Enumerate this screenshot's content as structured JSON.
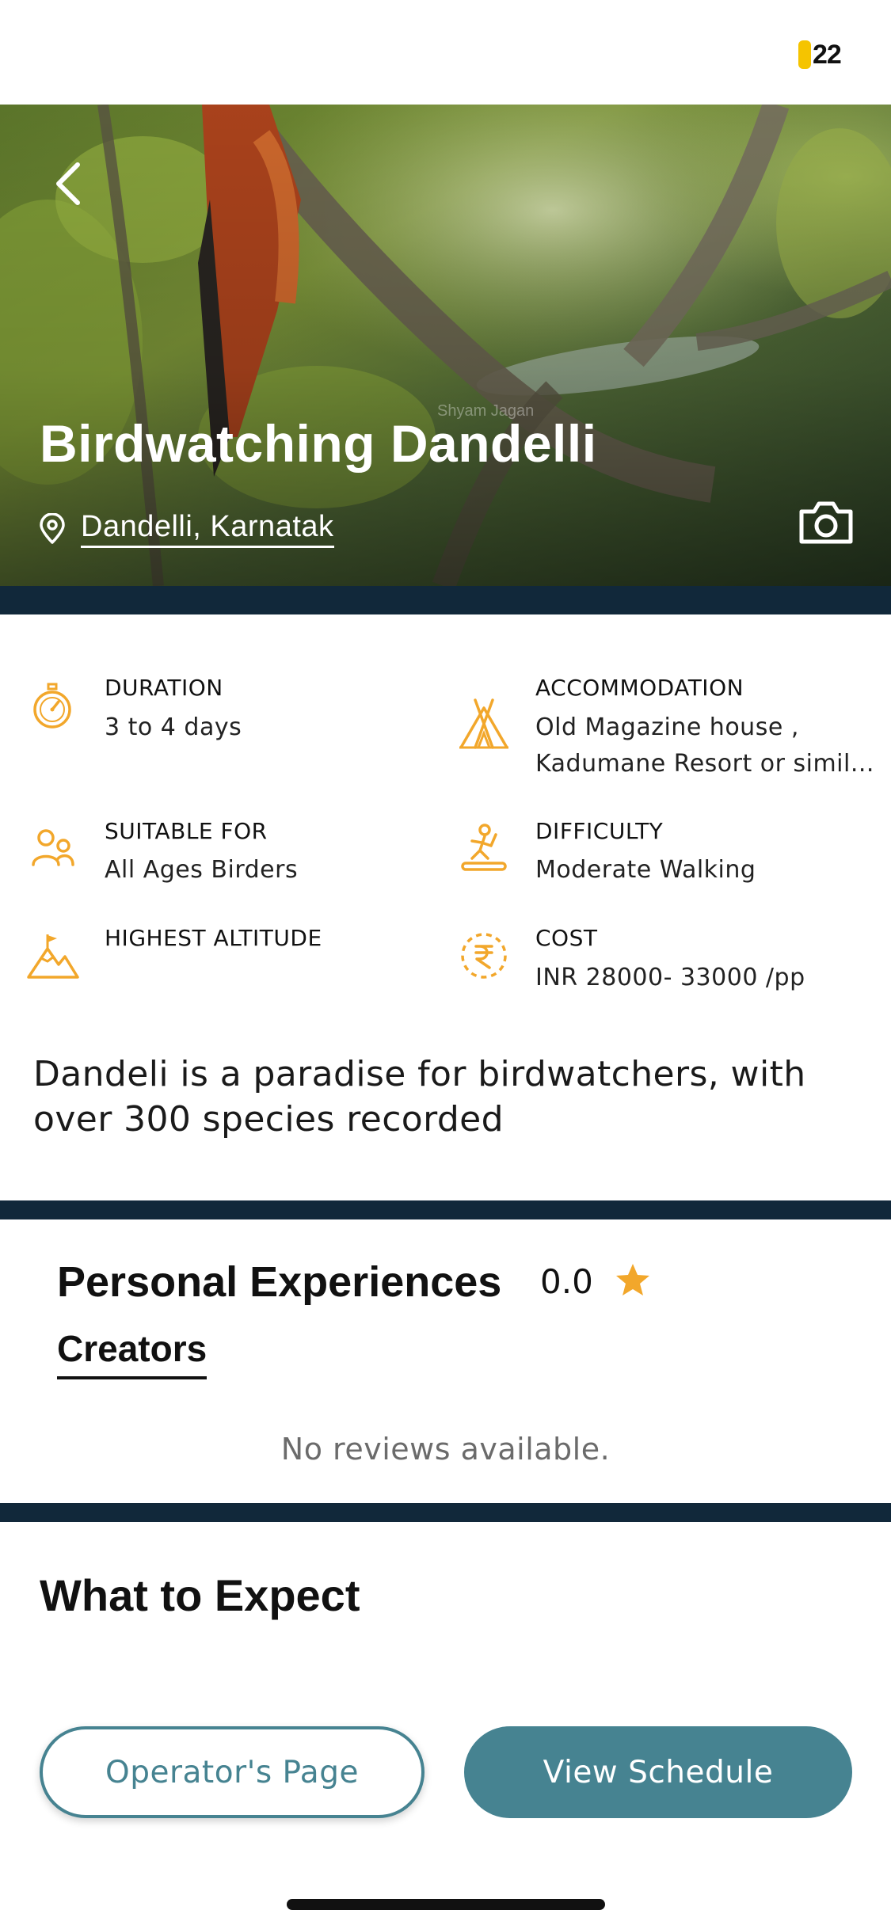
{
  "status": {
    "battery": "22"
  },
  "hero": {
    "title": "Birdwatching Dandelli",
    "location": "Dandelli, Karnatak",
    "watermark": "Shyam Jagan",
    "icons": [
      "back-icon",
      "location-pin-icon",
      "camera-icon"
    ]
  },
  "details": {
    "duration": {
      "label": "DURATION",
      "value": "3 to 4 days",
      "icon": "stopwatch-icon"
    },
    "accommodation": {
      "label": "ACCOMMODATION",
      "value_line1": "Old Magazine house ,",
      "value_line2": "Kadumane Resort or simil...",
      "icon": "tent-icon"
    },
    "suitable": {
      "label": "SUITABLE FOR",
      "value": "All Ages Birders",
      "icon": "people-icon"
    },
    "difficulty": {
      "label": "DIFFICULTY",
      "value": "Moderate Walking",
      "icon": "treadmill-icon"
    },
    "altitude": {
      "label": "HIGHEST ALTITUDE",
      "value": "",
      "icon": "mountain-flag-icon"
    },
    "cost": {
      "label": "COST",
      "value": "INR 28000- 33000 /pp",
      "icon": "rupee-icon"
    }
  },
  "description": "Dandeli is a paradise for birdwatchers, with over 300 species recorded",
  "experiences": {
    "title": "Personal Experiences",
    "rating": "0.0",
    "tab": "Creators",
    "empty": "No reviews available."
  },
  "expect": {
    "title": "What to Expect"
  },
  "actions": {
    "operator": "Operator's Page",
    "schedule": "View Schedule"
  },
  "colors": {
    "accent": "#F2A72B",
    "teal": "#468391",
    "navy_band": "#11283A"
  }
}
